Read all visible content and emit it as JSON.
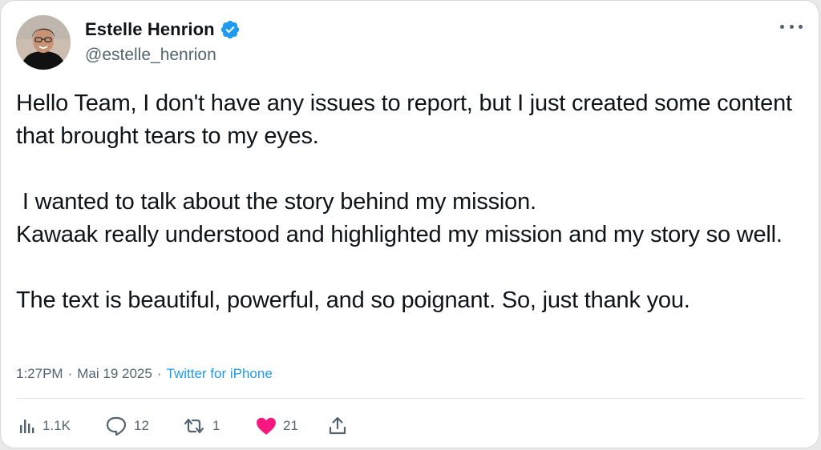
{
  "author": {
    "display_name": "Estelle Henrion",
    "handle": "@estelle_henrion",
    "verified": true,
    "verified_color": "#1d9bf0"
  },
  "tweet": {
    "text": "Hello Team, I don't have any issues to report, but I just created some content that brought tears to my eyes.\n\n I wanted to talk about the story behind my mission.\nKawaak really understood and highlighted my mission and my story so well.\n\nThe text is beautiful, powerful, and so poignant. So, just thank you."
  },
  "meta": {
    "time": "1:27PM",
    "separator": "·",
    "date": "Mai 19 2025",
    "source": "Twitter for iPhone"
  },
  "actions": {
    "views": "1.1K",
    "replies": "12",
    "retweets": "1",
    "likes": "21",
    "like_color": "#f91880"
  },
  "icons": {
    "menu": "more-icon",
    "views": "bar-chart-icon",
    "reply": "speech-bubble-icon",
    "retweet": "retweet-icon",
    "like": "heart-icon",
    "share": "share-icon"
  }
}
